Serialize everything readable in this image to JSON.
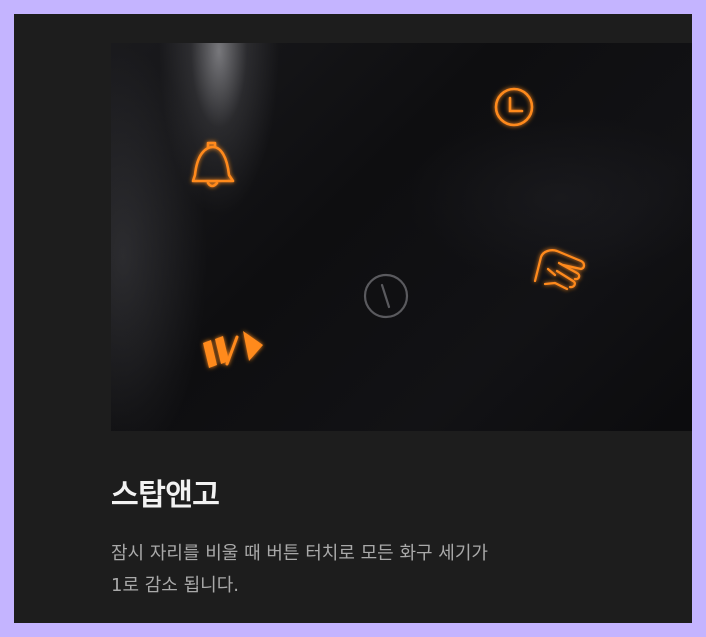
{
  "feature": {
    "title": "스탑앤고",
    "description_lines": [
      "잠시 자리를 비울 때 버튼 터치로 모든 화구 세기가",
      "1로 감소 됩니다."
    ]
  },
  "photo": {
    "icons": [
      "bell-icon",
      "clock-icon",
      "power-icon",
      "stop-and-go-icon",
      "hand-touch-icon"
    ],
    "icon_color": "#ff8a1f",
    "inactive_icon_color": "#5a5a5e"
  },
  "colors": {
    "page_border": "#c4b4ff",
    "card_background": "#1d1d1d",
    "title": "#f2f2f2",
    "description": "#a9a9a9"
  }
}
